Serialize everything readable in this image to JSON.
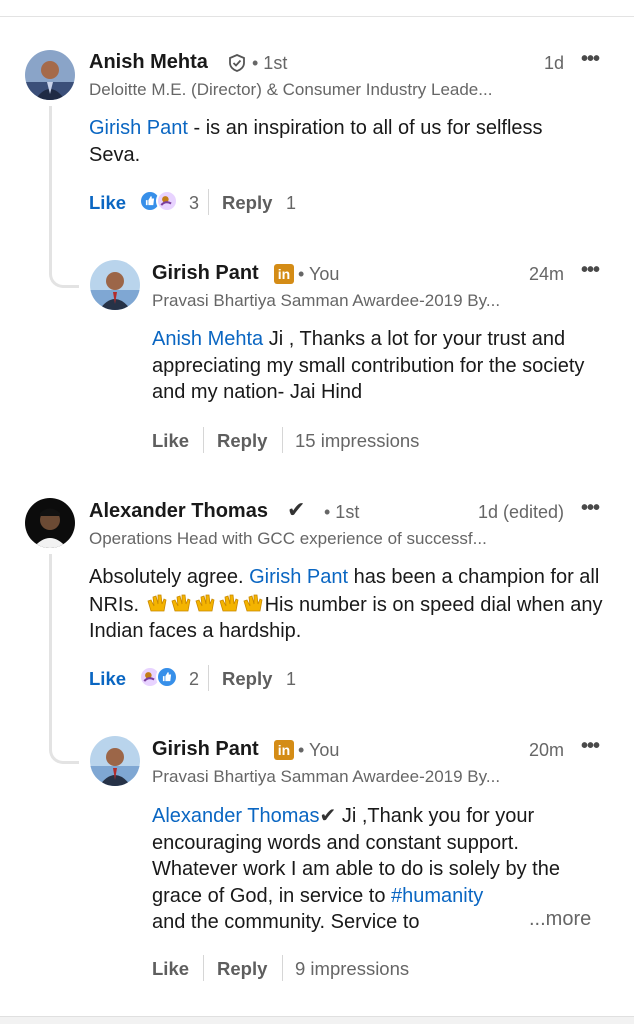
{
  "comments": [
    {
      "name": "Anish Mehta",
      "verified_icon": "shield-check-icon",
      "degree": "• 1st",
      "headline": "Deloitte M.E. (Director) & Consumer Industry Leade...",
      "time": "1d",
      "body_mention": "Girish Pant",
      "body_rest": " - is an inspiration to all of us for selfless Seva.",
      "like_label": "Like",
      "reaction_count": "3",
      "reply_label": "Reply",
      "reply_count": "1",
      "reply": {
        "name": "Girish Pant",
        "badge": "in",
        "degree": "• You",
        "headline": "Pravasi Bhartiya Samman Awardee-2019 By...",
        "time": "24m",
        "body_mention": "Anish Mehta",
        "body_rest": " Ji , Thanks a lot for your trust and appreciating my small contribution for the society and my nation- Jai Hind",
        "like_label": "Like",
        "reply_label": "Reply",
        "impressions": "15 impressions"
      }
    },
    {
      "name": "Alexander Thomas",
      "check": "✔",
      "degree": "• 1st",
      "headline": "Operations Head with GCC experience of successf...",
      "time": "1d (edited)",
      "body_pre": "Absolutely agree. ",
      "body_mention": "Girish Pant",
      "body_mid": " has been a champion for all NRIs. ",
      "body_post": "His number is on speed dial when any Indian faces a hardship.",
      "like_label": "Like",
      "reaction_count": "2",
      "reply_label": "Reply",
      "reply_count": "1",
      "reply": {
        "name": "Girish Pant",
        "badge": "in",
        "degree": "• You",
        "headline": "Pravasi Bhartiya Samman Awardee-2019 By...",
        "time": "20m",
        "body_mention": "Alexander Thomas",
        "body_check": "✔",
        "body_rest": " Ji ,Thank you for your encouraging words and constant support. Whatever work I am able to do is solely by the grace of God, in service to ",
        "hashtag": "#humanity",
        "body_end": "and the community. Service to",
        "more_label": "...more",
        "like_label": "Like",
        "reply_label": "Reply",
        "impressions": "9 impressions"
      }
    }
  ],
  "overflow_icon": "more-horizontal-icon",
  "colors": {
    "link": "#0a66c2",
    "muted": "#666666",
    "badge": "#d48c16"
  }
}
